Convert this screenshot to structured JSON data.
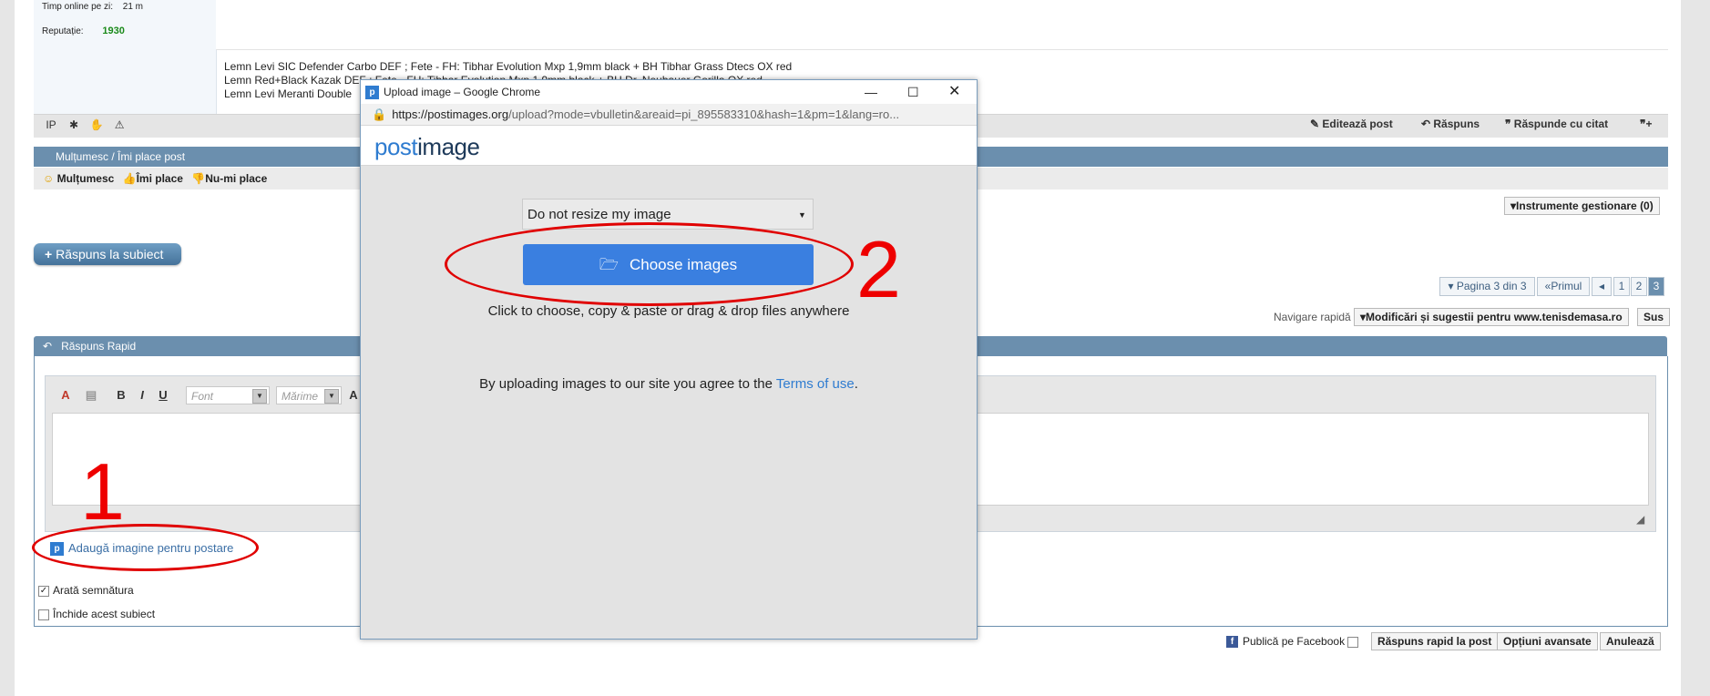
{
  "profile": {
    "online_label": "Timp online pe zi:",
    "online_value": "21 m",
    "rep_label": "Reputație:",
    "rep_value": "1930"
  },
  "signature": {
    "lines": [
      "Lemn Levi SIC Defender Carbo DEF ; Fete - FH: Tibhar Evolution Mxp 1,9mm black + BH Tibhar Grass Dtecs OX red",
      "Lemn Red+Black Kazak DEF ; Fete - FH: Tibhar Evolution Mxp 1,9mm black + BH Dr. Neubauer Gorilla OX red",
      "Lemn Levi Meranti Double"
    ]
  },
  "post_actions": {
    "edit": "Editează post",
    "reply": "Răspuns",
    "quote": "Răspunde cu citat"
  },
  "thanks": {
    "header": "Mulțumesc / Îmi place post",
    "thank": "Mulțumesc",
    "like": "Îmi place",
    "dislike": "Nu-mi place"
  },
  "tools_button": "Instrumente gestionare (0)",
  "reply_button": "Răspuns la subiect",
  "pagination": {
    "label": "Pagina 3 din 3",
    "first": "Primul",
    "pages": [
      "1",
      "2",
      "3"
    ]
  },
  "quicknav": {
    "label": "Navigare rapidă",
    "select": "Modificări și sugestii pentru www.tenisdemasa.ro",
    "top": "Sus"
  },
  "quick_reply": {
    "header": "Răspuns Rapid",
    "font_placeholder": "Font",
    "size_placeholder": "Mărime",
    "add_image": "Adaugă imagine pentru postare",
    "show_signature": "Arată semnătura",
    "close_thread": "Închide acest subiect"
  },
  "footer": {
    "facebook": "Publică pe Facebook",
    "submit": "Răspuns rapid la post",
    "advanced": "Opțiuni avansate",
    "cancel": "Anulează"
  },
  "popup": {
    "title": "Upload image – Google Chrome",
    "url_domain": "https://postimages.org",
    "url_path": "/upload?mode=vbulletin&areaid=pi_895583310&hash=1&pm=1&lang=ro...",
    "logo_a": "post",
    "logo_b": "image",
    "resize_option": "Do not resize my image",
    "choose": "Choose images",
    "hint": "Click to choose, copy & paste or drag & drop files anywhere",
    "terms_prefix": "By uploading images to our site you agree to the ",
    "terms_link": "Terms of use",
    "terms_suffix": "."
  },
  "annotations": {
    "one": "1",
    "two": "2"
  },
  "colors": {
    "accent": "#3a7fe0",
    "header_blue": "#6b8fae",
    "annotation_red": "#e00000"
  }
}
